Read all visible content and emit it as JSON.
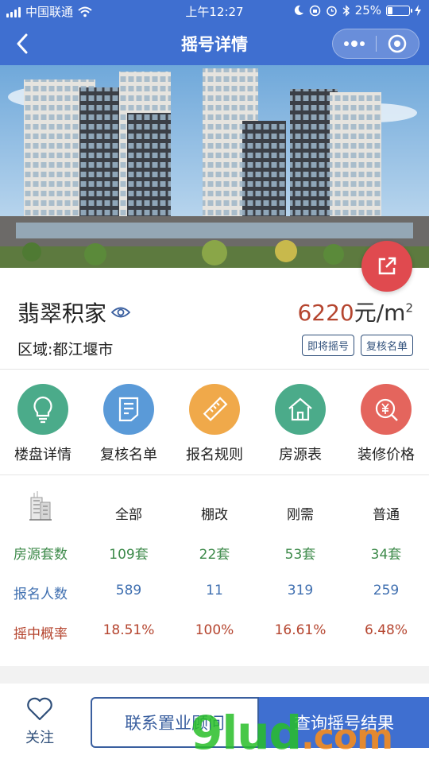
{
  "status_bar": {
    "carrier": "中国联通",
    "time": "上午12:27",
    "battery": "25%",
    "battery_level": 0.25
  },
  "nav": {
    "title": "摇号详情",
    "back_icon": "chevron-left-icon",
    "more_icon": "more-dots-icon",
    "close_icon": "target-circle-icon"
  },
  "project": {
    "name": "翡翠积家",
    "price_value": "6220",
    "price_unit": "元/m",
    "price_unit_sup": "2",
    "region": "区域:都江堰市",
    "tags": [
      "即将摇号",
      "复核名单"
    ]
  },
  "menu": [
    {
      "label": "楼盘详情",
      "icon": "lightbulb-icon",
      "color": "#4bab8a"
    },
    {
      "label": "复核名单",
      "icon": "document-list-icon",
      "color": "#5a9ad8"
    },
    {
      "label": "报名规则",
      "icon": "ruler-icon",
      "color": "#f0a94a"
    },
    {
      "label": "房源表",
      "icon": "house-icon",
      "color": "#4bab8a"
    },
    {
      "label": "装修价格",
      "icon": "yen-search-icon",
      "color": "#e4655d"
    }
  ],
  "stats": {
    "columns": [
      "全部",
      "棚改",
      "刚需",
      "普通"
    ],
    "rows": [
      {
        "label": "房源套数",
        "values": [
          "109套",
          "22套",
          "53套",
          "34套"
        ],
        "color": "#3d8a4a"
      },
      {
        "label": "报名人数",
        "values": [
          "589",
          "11",
          "319",
          "259"
        ],
        "color": "#3f6fb0"
      },
      {
        "label": "摇中概率",
        "values": [
          "18.51%",
          "100%",
          "16.61%",
          "6.48%"
        ],
        "color": "#b5452f"
      }
    ]
  },
  "bottom_bar": {
    "follow_label": "关注",
    "contact_label": "联系置业顾问",
    "result_label": "查询摇号结果"
  },
  "watermark": {
    "main": "9lud",
    "suffix": ".com"
  },
  "colors": {
    "primary": "#3f6fd0",
    "accent_red": "#e04a4f",
    "price": "#b5452f"
  }
}
